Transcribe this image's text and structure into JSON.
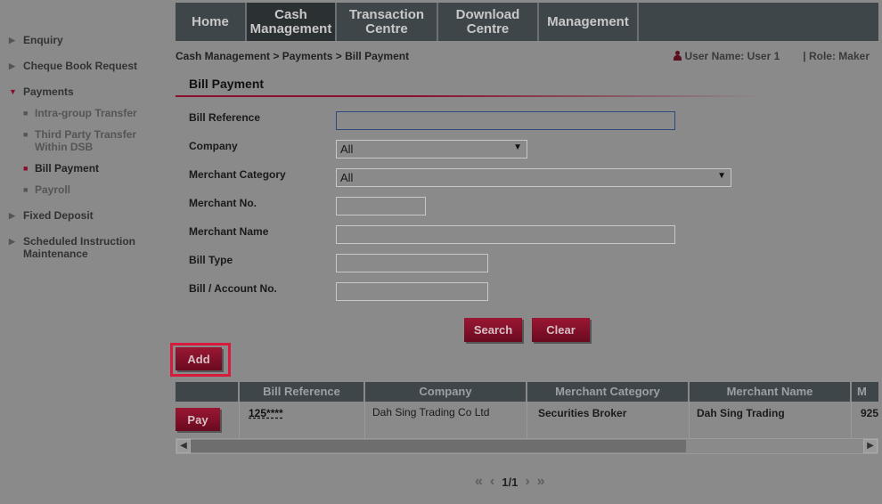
{
  "sidebar": {
    "items": [
      {
        "label": "Enquiry"
      },
      {
        "label": "Cheque Book Request"
      },
      {
        "label": "Payments"
      },
      {
        "label": "Fixed Deposit"
      },
      {
        "label": "Scheduled Instruction Maintenance"
      }
    ],
    "payments_sub": [
      {
        "label": "Intra-group Transfer"
      },
      {
        "label": "Third Party Transfer Within DSB"
      },
      {
        "label": "Bill Payment"
      },
      {
        "label": "Payroll"
      }
    ]
  },
  "nav": {
    "items": [
      {
        "label": "Home"
      },
      {
        "label": "Cash\nManagement"
      },
      {
        "label": "Transaction\nCentre"
      },
      {
        "label": "Download\nCentre"
      },
      {
        "label": "Management"
      }
    ]
  },
  "breadcrumb": "Cash Management > Payments > Bill Payment",
  "user": {
    "name": "User Name: User 1",
    "role": "| Role: Maker"
  },
  "page_title": "Bill Payment",
  "form": {
    "bill_reference": {
      "label": "Bill Reference",
      "value": ""
    },
    "company": {
      "label": "Company",
      "value": "All"
    },
    "merchant_category": {
      "label": "Merchant Category",
      "value": "All"
    },
    "merchant_no": {
      "label": "Merchant No.",
      "value": ""
    },
    "merchant_name": {
      "label": "Merchant Name",
      "value": ""
    },
    "bill_type": {
      "label": "Bill Type",
      "value": ""
    },
    "bill_account_no": {
      "label": "Bill / Account No.",
      "value": ""
    }
  },
  "buttons": {
    "search": "Search",
    "clear": "Clear",
    "add": "Add",
    "pay": "Pay"
  },
  "table": {
    "headers": [
      "",
      "Bill Reference",
      "Company",
      "Merchant Category",
      "Merchant Name",
      "M"
    ],
    "rows": [
      {
        "bill_reference": "125****",
        "company": "Dah Sing Trading Co Ltd",
        "merchant_category": "Securities Broker",
        "merchant_name": "Dah Sing Trading",
        "merchant_no": "925"
      }
    ]
  },
  "pager": {
    "page": "1/1"
  },
  "icons": {
    "user": "user-icon",
    "first": "double-chevron-left-icon",
    "prev": "chevron-left-icon",
    "next": "chevron-right-icon",
    "last": "double-chevron-right-icon"
  },
  "colors": {
    "accent": "#8b0e2c",
    "nav": "#3f464a",
    "highlight": "#d81b3c"
  }
}
